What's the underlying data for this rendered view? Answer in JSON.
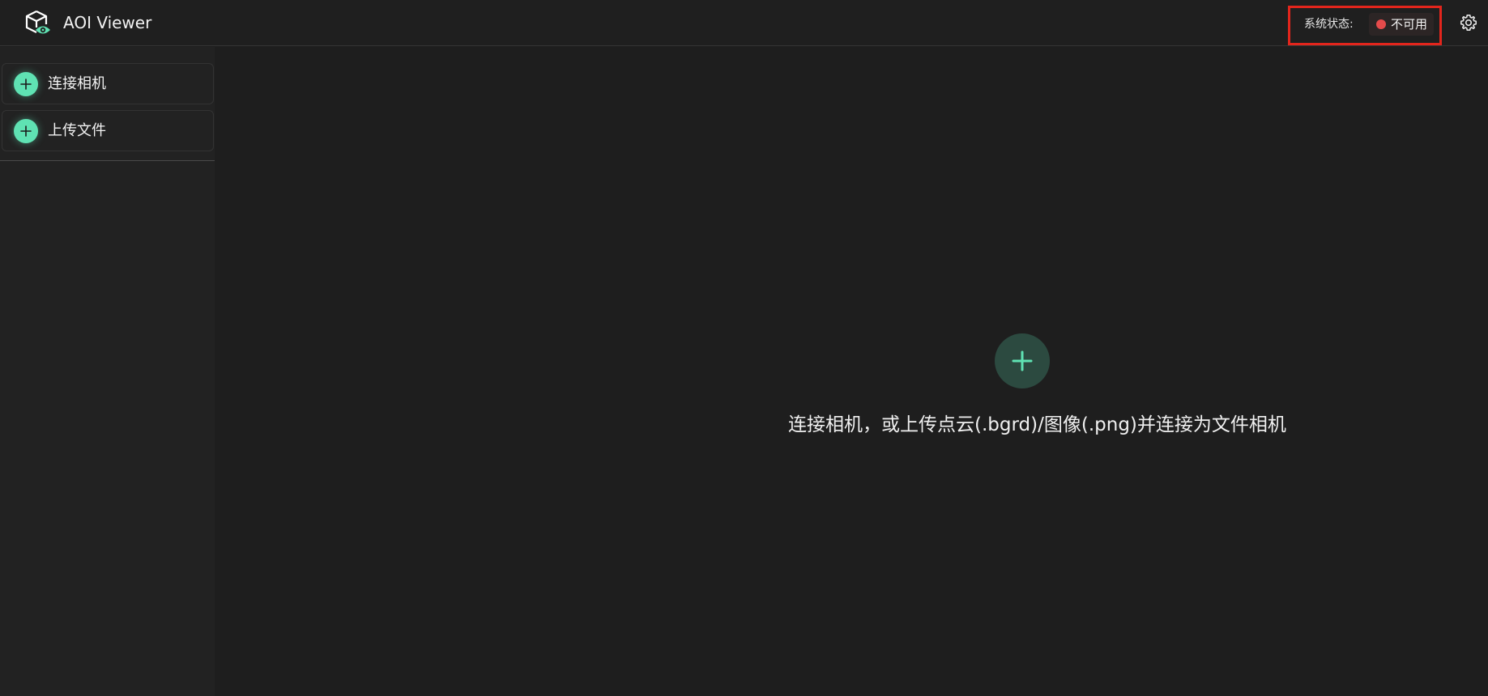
{
  "header": {
    "app_title": "AOI Viewer",
    "status_label": "系统状态:",
    "status_value": "不可用",
    "status_color": "#e54b4b",
    "logo_icon": "cube-eye-icon",
    "settings_icon": "gear-icon"
  },
  "sidebar": {
    "items": [
      {
        "label": "连接相机",
        "icon": "plus-circle-icon"
      },
      {
        "label": "上传文件",
        "icon": "plus-circle-icon"
      }
    ]
  },
  "main": {
    "empty_hint": "连接相机，或上传点云(.bgrd)/图像(.png)并连接为文件相机",
    "add_icon": "plus-icon"
  },
  "colors": {
    "accent": "#5fe2b3",
    "accent_dark": "#2c4a40",
    "background": "#1e1e1e",
    "alert_border": "#e3251c"
  }
}
